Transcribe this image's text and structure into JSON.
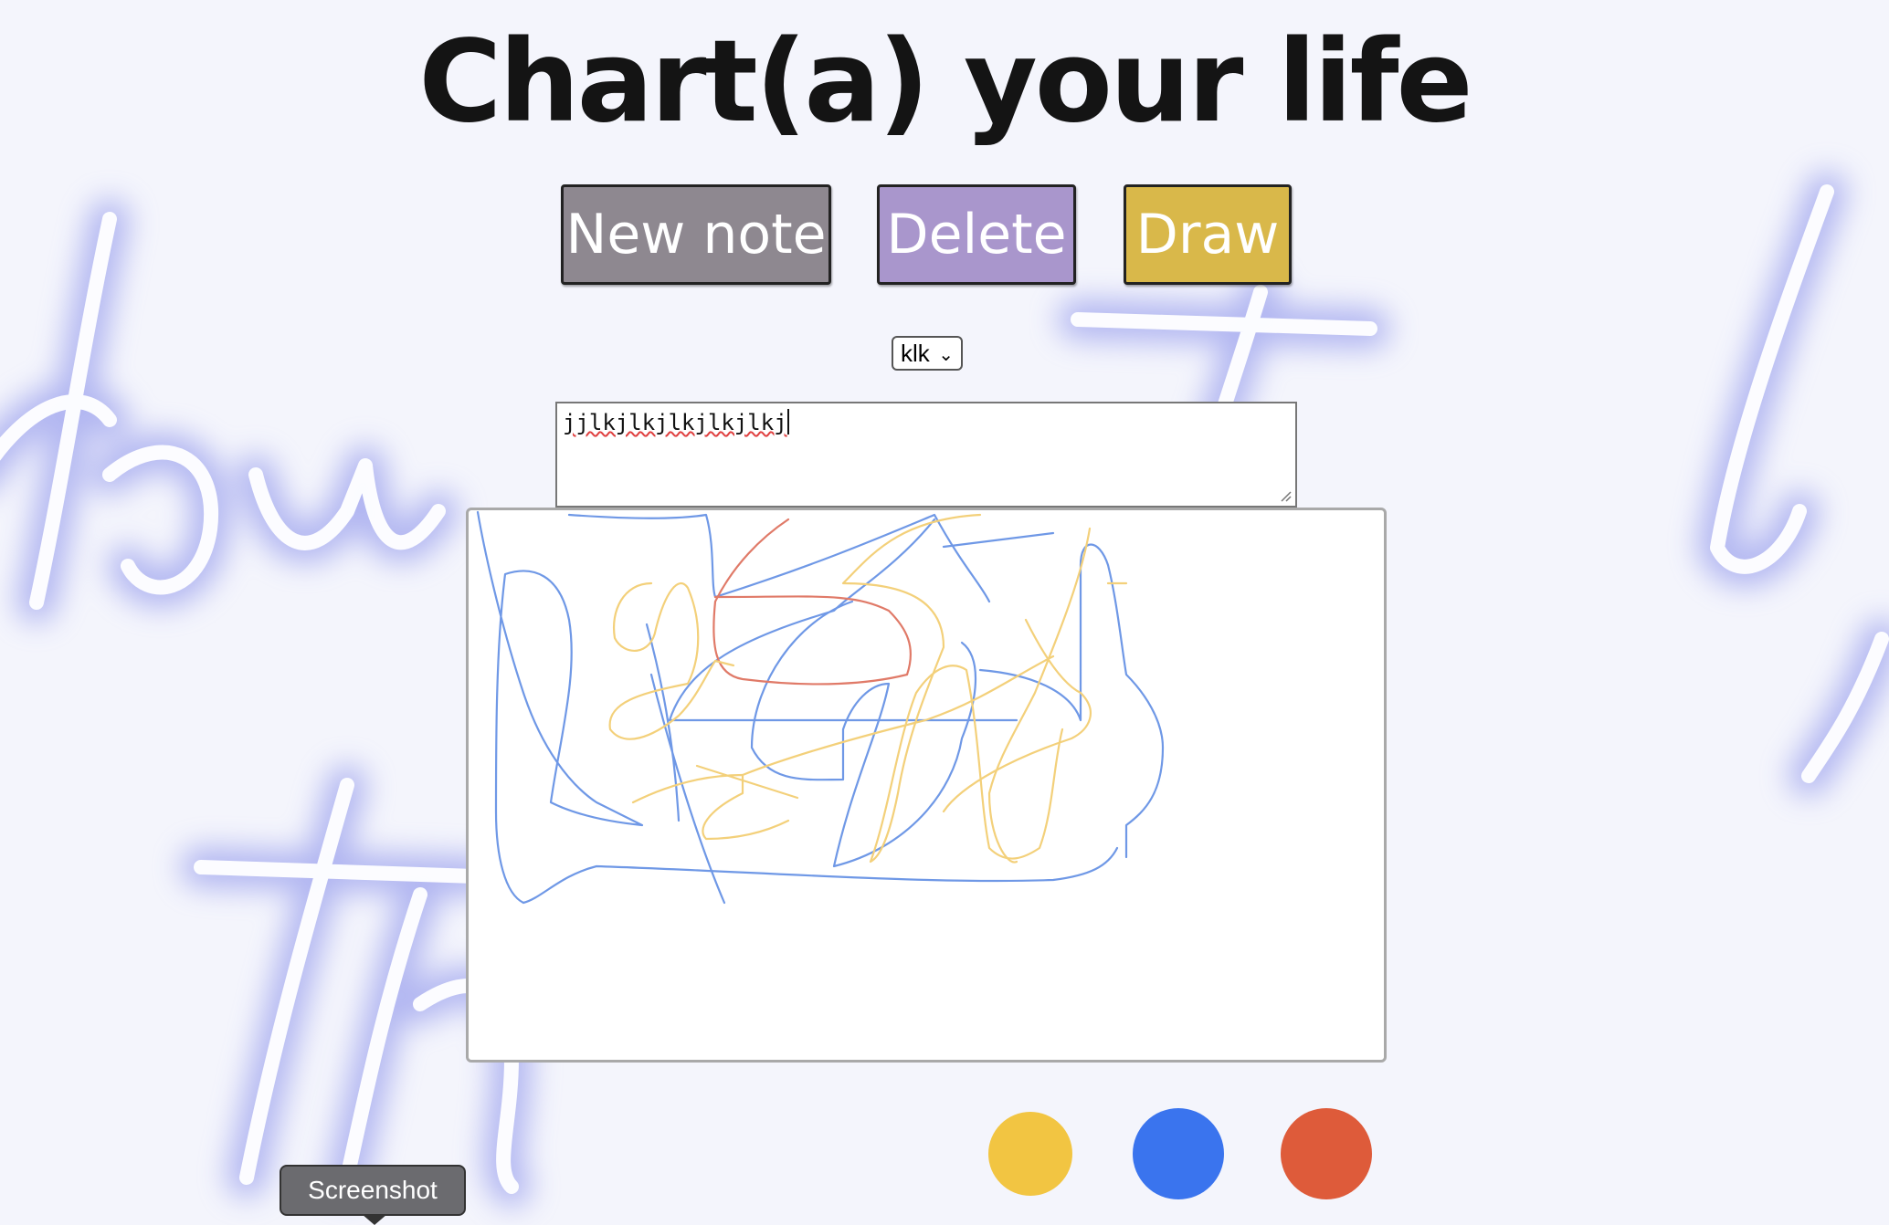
{
  "header": {
    "title": "Chart(a) your life"
  },
  "toolbar": {
    "new_note_label": "New note",
    "delete_label": "Delete",
    "draw_label": "Draw"
  },
  "note_selector": {
    "selected": "klk"
  },
  "note_editor": {
    "value": "jjlkjlkjlkjlkjlkj"
  },
  "palette": {
    "colors": [
      {
        "name": "yellow",
        "hex": "#f2c542"
      },
      {
        "name": "blue",
        "hex": "#3a74ee"
      },
      {
        "name": "red",
        "hex": "#de5b3a"
      }
    ]
  },
  "tooltip": {
    "text": "Screenshot"
  }
}
